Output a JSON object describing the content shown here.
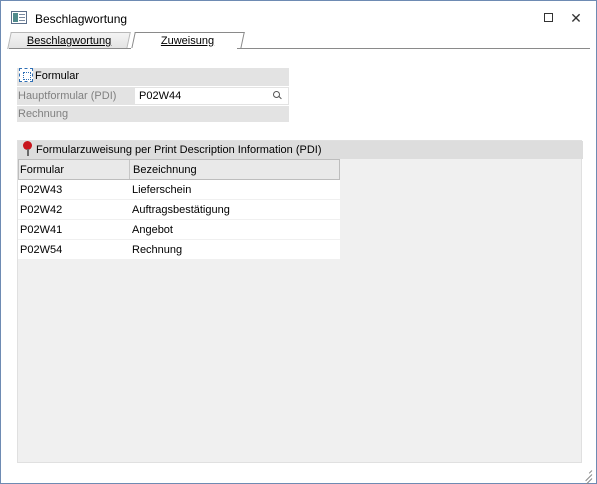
{
  "window": {
    "title": "Beschlagwortung"
  },
  "tabs": [
    {
      "label": "Beschlagwortung",
      "active": false
    },
    {
      "label": "Zuweisung",
      "active": true
    }
  ],
  "formular": {
    "section_title": "Formular",
    "hauptformular_label": "Hauptformular (PDI)",
    "hauptformular_value": "P02W44",
    "rechnung_label": "Rechnung"
  },
  "pdi": {
    "section_title": "Formularzuweisung per Print Description Information (PDI)",
    "columns": [
      "Formular",
      "Bezeichnung"
    ],
    "rows": [
      {
        "formular": "P02W43",
        "bezeichnung": "Lieferschein"
      },
      {
        "formular": "P02W42",
        "bezeichnung": "Auftragsbestätigung"
      },
      {
        "formular": "P02W41",
        "bezeichnung": "Angebot"
      },
      {
        "formular": "P02W54",
        "bezeichnung": "Rechnung"
      }
    ]
  },
  "icons": {
    "app": "window-app-icon",
    "formular": "form-icon",
    "lookup": "search-icon",
    "pdi": "pin-icon"
  },
  "colors": {
    "section_bg": "#e3e3e3",
    "label_gray": "#808080",
    "pin_red": "#c8161d"
  }
}
